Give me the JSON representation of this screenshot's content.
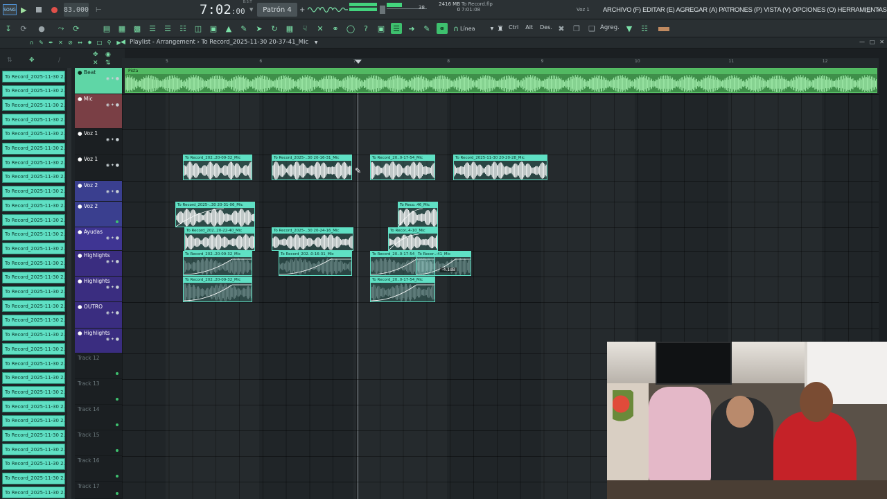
{
  "transport": {
    "mode_label": "SONG",
    "tempo": "83.000",
    "time": "7:02",
    "time_frames": ":00",
    "time_sub": "B:S:T",
    "pattern": "Patrón 4",
    "cpu_value": "38",
    "mem_mb": "2416 MB",
    "mem_zero": "0",
    "hint_file": "To Record.flp",
    "hint_time": "7:01:08",
    "voice_label": "Voz 1"
  },
  "menu": {
    "items": "ARCHIVO (F) EDITAR (E) AGREGAR (A) PATRONES (P) VISTA (V) OPCIONES (O) HERRAMIENTAS (T) AYUDA"
  },
  "toolbar": {
    "snap": "Línea",
    "ctrl_label": "Ctrl",
    "alt_label": "Alt",
    "des_label": "Des.",
    "agreg_label": "Agreg."
  },
  "playlist": {
    "title": "Playlist - Arrangement",
    "breadcrumb": "To Record_2025-11-30 20-37-41_Mic"
  },
  "clip_list": [
    "To Record_2025-11-30 2...",
    "To Record_2025-11-30 2...",
    "To Record_2025-11-30 2...",
    "To Record_2025-11-30 2...",
    "To Record_2025-11-30 2...",
    "To Record_2025-11-30 2...",
    "To Record_2025-11-30 2...",
    "To Record_2025-11-30 2...",
    "To Record_2025-11-30 2...",
    "To Record_2025-11-30 2...",
    "To Record_2025-11-30 2...",
    "To Record_2025-11-30 2...",
    "To Record_2025-11-30 2...",
    "To Record_2025-11-30 2...",
    "To Record_2025-11-30 2...",
    "To Record_2025-11-30 2...",
    "To Record_2025-11-30 2...",
    "To Record_2025-11-30 2...",
    "To Record_2025-11-30 2...",
    "To Record_2025-11-30 2...",
    "To Record_2025-11-30 2...",
    "To Record_2025-11-30 2...",
    "To Record_2025-11-30 2...",
    "To Record_2025-11-30 2...",
    "To Record_2025-11-30 2...",
    "To Record_2025-11-30 2...",
    "To Record_2025-11-30 2...",
    "To Record_2025-11-30 2...",
    "To Record_2025-11-30 2...",
    "To Record_2025-11-30 2..."
  ],
  "tracks": [
    "Beat",
    "Mic",
    "Voz 1",
    "Voz 1",
    "Voz 2",
    "Voz 2",
    "Ayudas",
    "Highlights",
    "Highlights",
    "OUTRO",
    "Highlights",
    "Track 12",
    "Track 13",
    "Track 14",
    "Track 15",
    "Track 16",
    "Track 17"
  ],
  "ruler_numbers": [
    "5",
    "6",
    "7",
    "8",
    "9",
    "10",
    "11",
    "12"
  ],
  "beat_clip_label": "Pista",
  "clips": [
    "To Record_202..20-09-32_Mic",
    "To Record_2025-..30 20-16-31_Mic",
    "To Record_20..0-17-54_Mic",
    "To Record_2025-11-30 20-20-28_Mic",
    "To Record_2025-..30 20-31-06_Mic",
    "To Reco..46_Mic",
    "To Record_202..20-22-40_Mic",
    "To Record_2025-..30 20-24-16_Mic",
    "To Recor..4-10_Mic",
    "To Record_202..20-09-32_Mic",
    "To Record_202..0-16-31_Mic",
    "To Record_20..0-17-54_Mic",
    "To Recor..-41_Mic",
    "To Record_202..20-09-32_Mic",
    "To Record_20..0-17-54_Mic"
  ],
  "clip_badge": "-4.1dB",
  "colors": {
    "accent": "#3ec06e",
    "clip": "#5fe0c4",
    "beat": "#52b962",
    "record": "#e0504a"
  }
}
